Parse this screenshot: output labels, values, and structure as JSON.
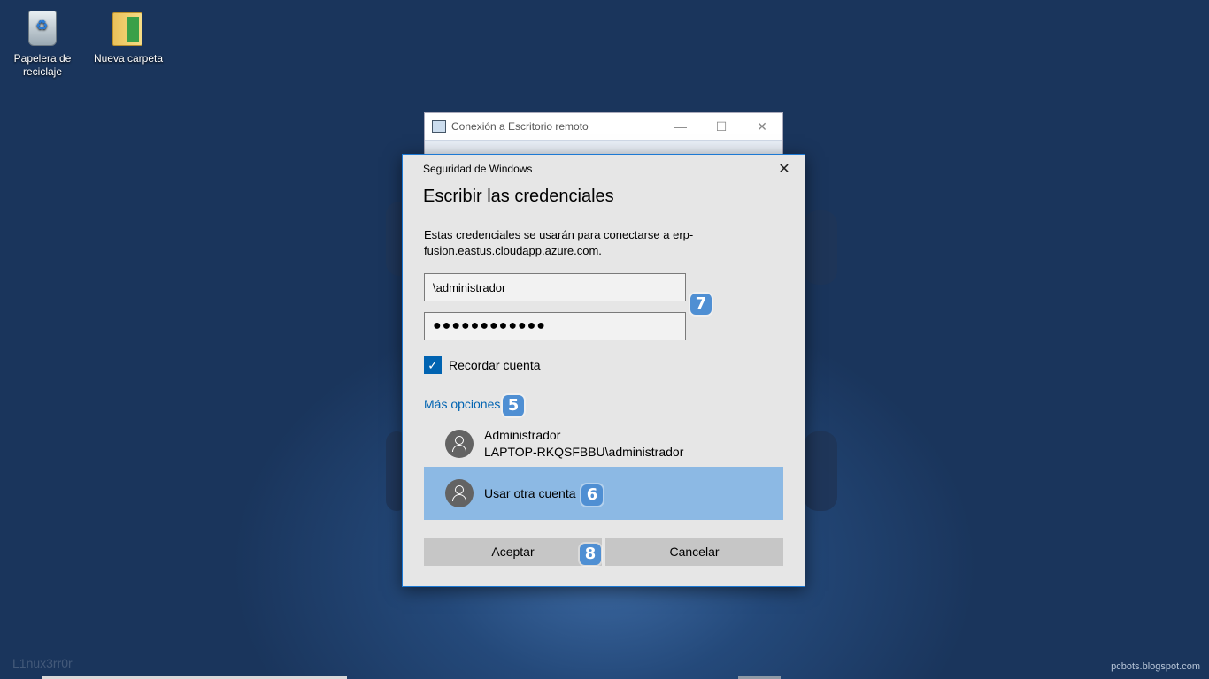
{
  "desktop": {
    "icons": [
      {
        "label": "Papelera de reciclaje",
        "icon": "recycle-bin-icon"
      },
      {
        "label": "Nueva carpeta",
        "icon": "folder-icon"
      }
    ],
    "watermark_left": "L1nux3rr0r",
    "watermark_right": "pcbots.blogspot.com"
  },
  "rdp_window": {
    "title": "Conexión a Escritorio remoto",
    "minimize": "—",
    "maximize": "☐",
    "close": "✕"
  },
  "dialog": {
    "window_title": "Seguridad de Windows",
    "close": "✕",
    "heading": "Escribir las credenciales",
    "description": "Estas credenciales se usarán para conectarse a erp-fusion.eastus.cloudapp.azure.com.",
    "username_value": "\\administrador",
    "password_value": "●●●●●●●●●●●●",
    "remember_label": "Recordar cuenta",
    "remember_checked": true,
    "more_options": "Más opciones",
    "accounts": [
      {
        "name": "Administrador",
        "detail": "LAPTOP-RKQSFBBU\\administrador"
      },
      {
        "name": "Usar otra cuenta"
      }
    ],
    "ok_label": "Aceptar",
    "cancel_label": "Cancelar",
    "selected_color": "#8cb9e4",
    "accent_color": "#0063b1"
  },
  "annotations": {
    "b5": "5",
    "b6": "6",
    "b7": "7",
    "b8": "8"
  }
}
